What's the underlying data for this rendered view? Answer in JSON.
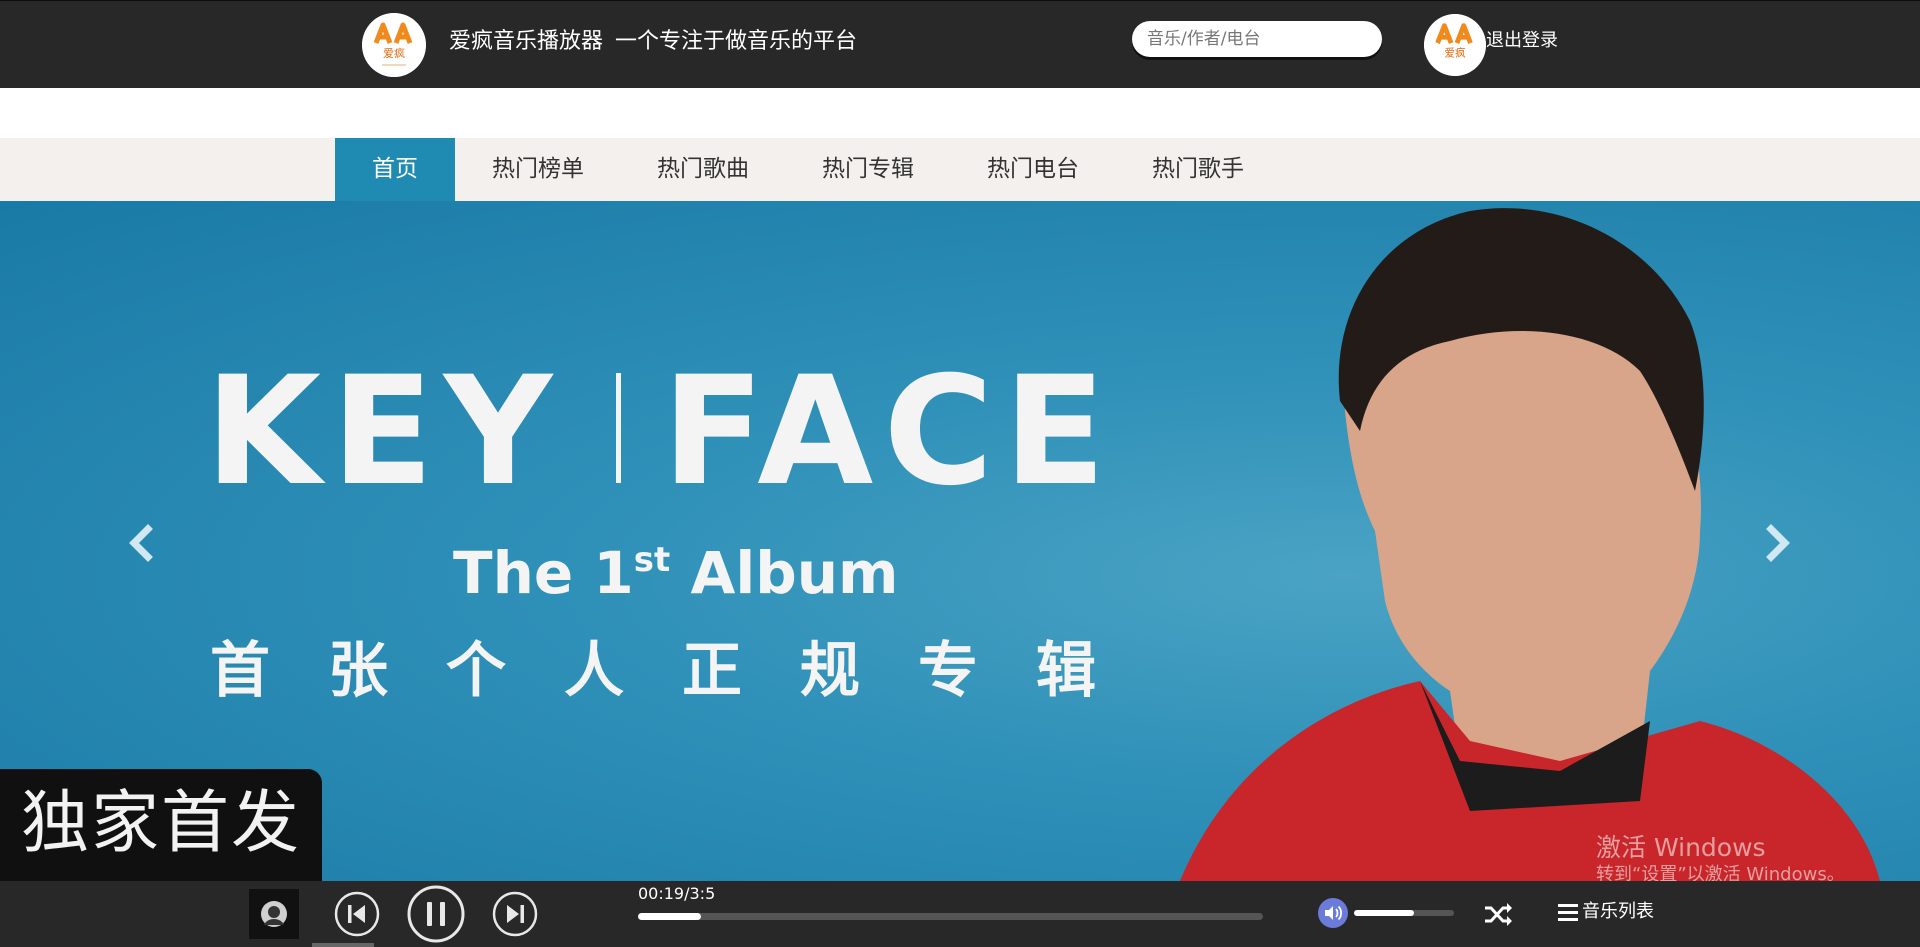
{
  "header": {
    "logo_text": "爱疯",
    "site_name": "爱疯音乐播放器",
    "slogan": "一个专注于做音乐的平台",
    "search_placeholder": "音乐/作者/电台",
    "logout_label": "退出登录"
  },
  "nav": {
    "items": [
      {
        "label": "首页",
        "active": true
      },
      {
        "label": "热门榜单"
      },
      {
        "label": "热门歌曲"
      },
      {
        "label": "热门专辑"
      },
      {
        "label": "热门电台"
      },
      {
        "label": "热门歌手"
      }
    ]
  },
  "banner": {
    "headline_left": "KEY",
    "headline_right": "FACE",
    "album_line": "The 1st Album",
    "album_line_main": "The 1",
    "album_line_sup": "st",
    "album_line_end": " Album",
    "subtitle": "首张个人正规专辑",
    "badge": "独家首发",
    "prev_icon": "chevron-left-icon",
    "next_icon": "chevron-right-icon"
  },
  "watermark": {
    "line1": "激活 Windows",
    "line2": "转到“设置”以激活 Windows。"
  },
  "player": {
    "time": "00:19/3:5",
    "progress": 0.1,
    "volume": 0.6,
    "playlist_label": "音乐列表",
    "state": "playing"
  },
  "colors": {
    "header_bg": "#282828",
    "nav_bg": "#f4f0ee",
    "nav_active": "#1f8bb3",
    "banner_blue": "#2f90b8",
    "volume_icon": "#6b7bd9"
  }
}
